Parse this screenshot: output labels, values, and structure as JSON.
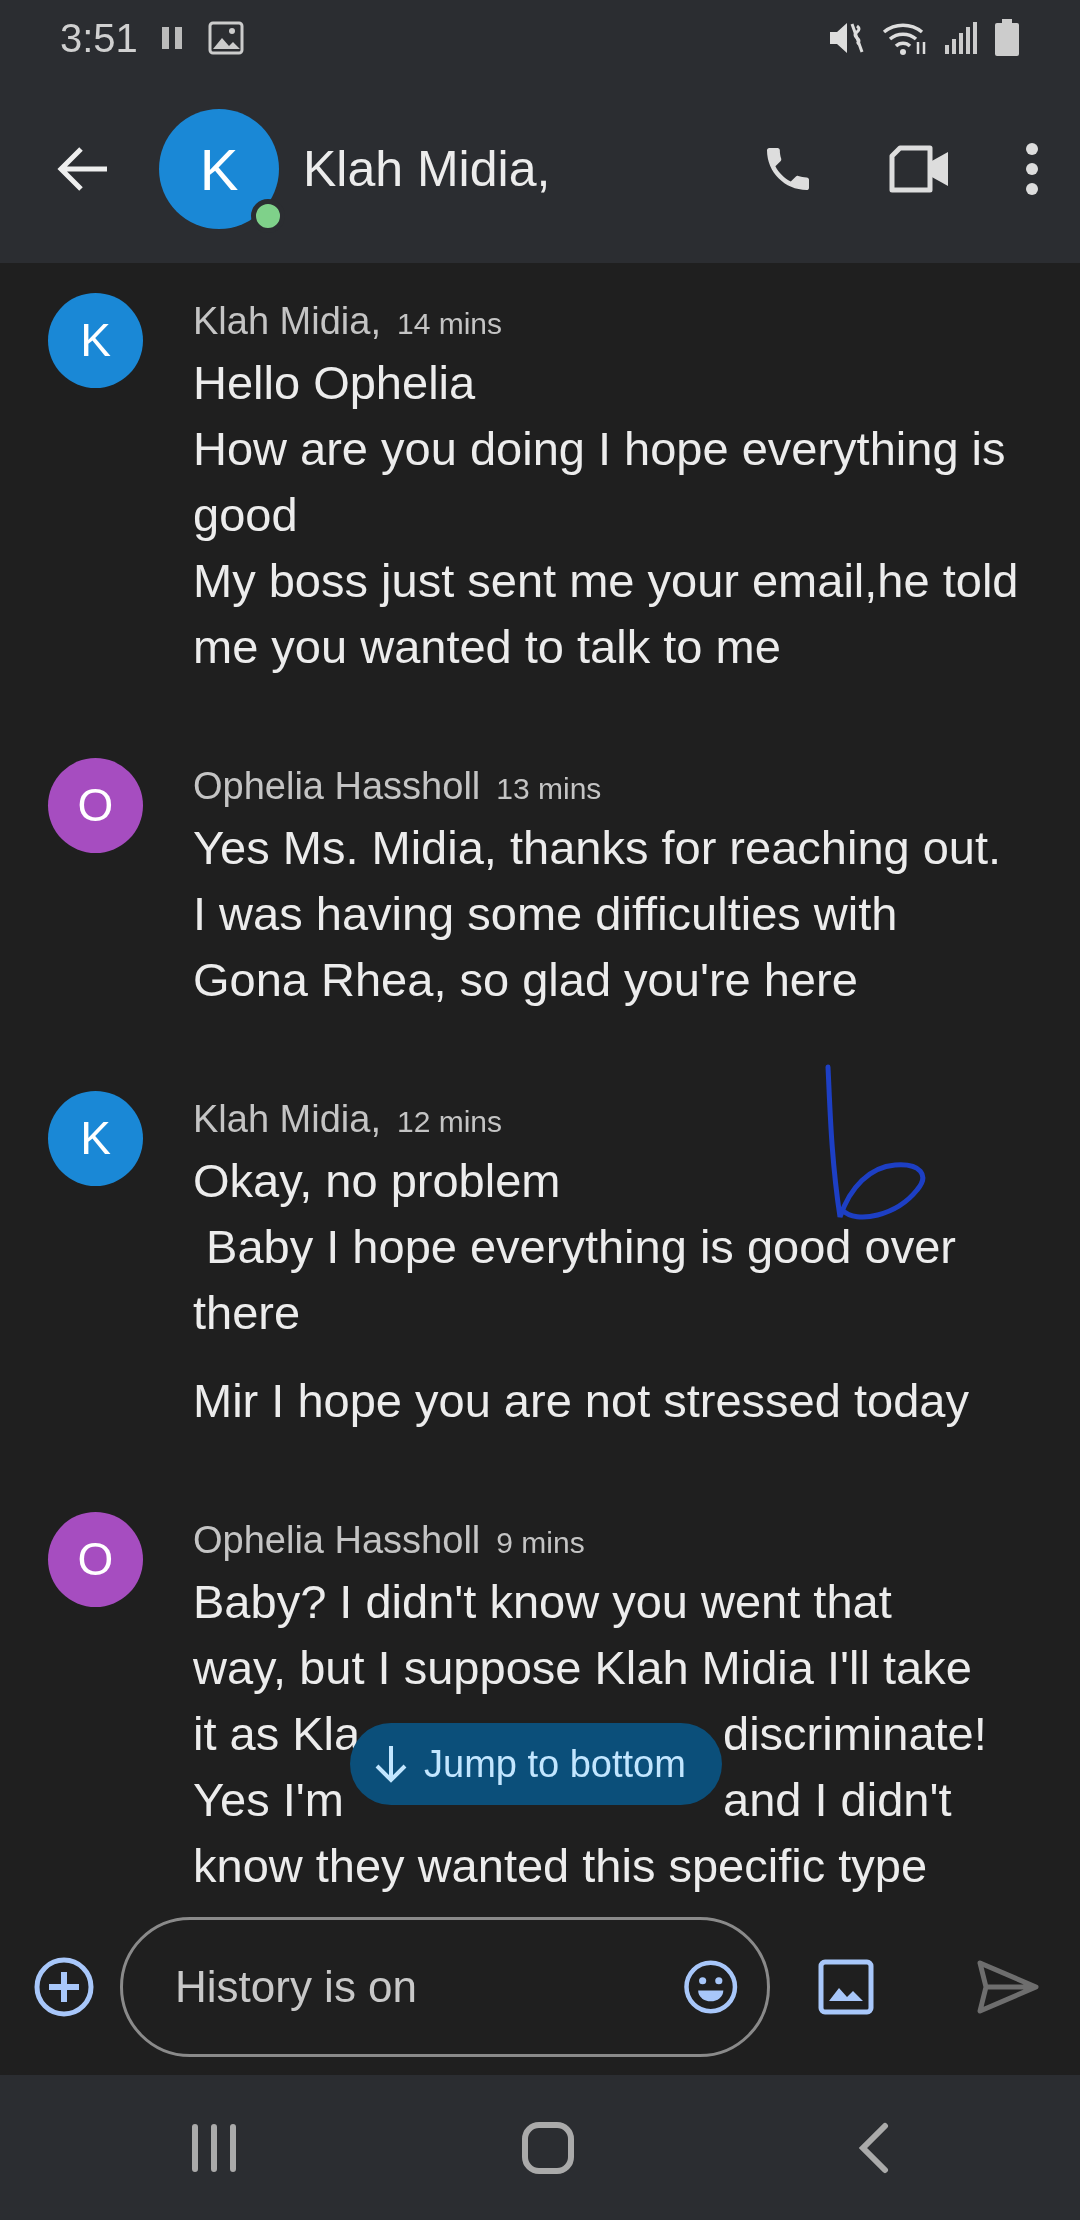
{
  "status_bar": {
    "time": "3:51"
  },
  "header": {
    "avatar_letter": "K",
    "online": true,
    "title": "Klah Midia,"
  },
  "messages": [
    {
      "avatar_letter": "K",
      "color": "#1a88d6",
      "sender": "Klah Midia,",
      "time": "14 mins",
      "bubbles": [
        {
          "lines": [
            [
              "Hello Ophelia"
            ],
            [
              "How are you doing I hope everything is good"
            ],
            [
              "My boss just sent me your email,he told me you wanted to talk to me"
            ]
          ]
        }
      ]
    },
    {
      "avatar_letter": "O",
      "color": "#a64dc0",
      "sender": "Ophelia Hassholl",
      "time": "13 mins",
      "bubbles": [
        {
          "lines": [
            [
              "Yes Ms. Midia, thanks for reaching out. I was having some difficulties with Gona Rhea, so glad you're here"
            ]
          ]
        }
      ]
    },
    {
      "avatar_letter": "K",
      "color": "#1a88d6",
      "sender": "Klah Midia,",
      "time": "12 mins",
      "bubbles": [
        {
          "lines": [
            [
              "Okay, no problem"
            ],
            [
              " Baby I hope everything is good over there"
            ]
          ]
        },
        {
          "lines": [
            [
              "Mir I hope you are not stressed today"
            ]
          ]
        }
      ]
    },
    {
      "avatar_letter": "O",
      "color": "#a64dc0",
      "sender": "Ophelia Hassholl",
      "time": "9 mins",
      "bubbles": [
        {
          "lines": [
            [
              "Baby? I didn't know you went that"
            ],
            [
              "way, but I suppose Klah Midia I'll take"
            ],
            [
              "it as Kla",
              "discriminate!"
            ],
            [
              "Yes I'm",
              "and I didn't"
            ],
            [
              "know they wanted this specific type"
            ]
          ]
        }
      ]
    }
  ],
  "jump_button": {
    "label": "Jump to bottom"
  },
  "composer": {
    "placeholder": "History is on",
    "send_enabled": false
  }
}
